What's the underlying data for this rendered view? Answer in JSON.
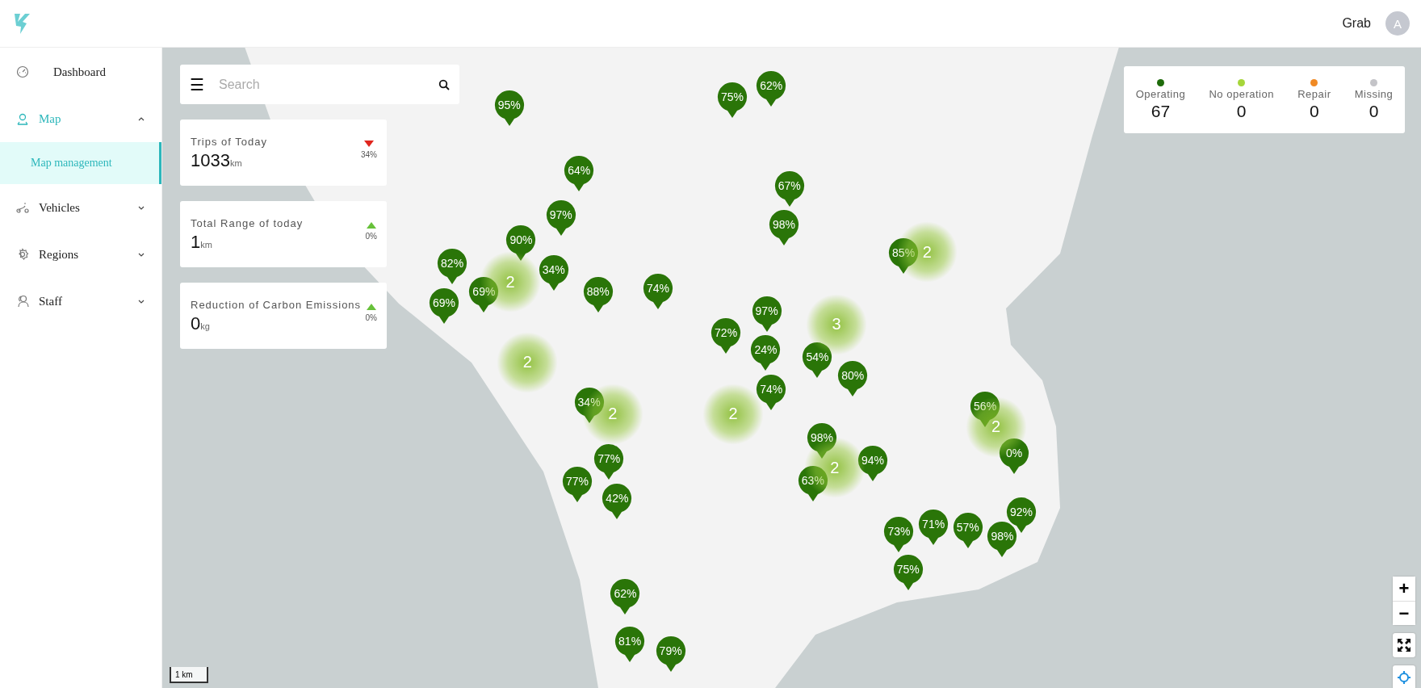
{
  "header": {
    "user_name": "Grab",
    "avatar_initial": "A"
  },
  "sidebar": {
    "items": [
      {
        "label": "Dashboard",
        "kind": "link",
        "selected": false
      },
      {
        "label": "Map",
        "kind": "group",
        "selected": true,
        "expanded": true,
        "children": [
          {
            "label": "Map management",
            "selected": true
          }
        ]
      },
      {
        "label": "Vehicles",
        "kind": "group",
        "selected": false,
        "expanded": false
      },
      {
        "label": "Regions",
        "kind": "group",
        "selected": false,
        "expanded": false
      },
      {
        "label": "Staff",
        "kind": "group",
        "selected": false,
        "expanded": false
      }
    ]
  },
  "search": {
    "menu_icon": "☰",
    "placeholder": "Search"
  },
  "stats": [
    {
      "title": "Trips of Today",
      "value": "1033",
      "unit": "km",
      "decreased": true,
      "change": "34%"
    },
    {
      "title": "Total Range of today",
      "value": "1",
      "unit": "km",
      "decreased": false,
      "change": "0%"
    },
    {
      "title": "Reduction of Carbon Emissions",
      "value": "0",
      "unit": "kg",
      "decreased": false,
      "change": "0%"
    }
  ],
  "status_legend": [
    {
      "label": "Operating",
      "count": "67",
      "color": "#1e6b0a"
    },
    {
      "label": "No operation",
      "count": "0",
      "color": "#a6d63a"
    },
    {
      "label": "Repair",
      "count": "0",
      "color": "#f08a24"
    },
    {
      "label": "Missing",
      "count": "0",
      "color": "#c4c4c8"
    }
  ],
  "vehicle_markers": [
    {
      "label": "95%"
    },
    {
      "label": "75%"
    },
    {
      "label": "62%"
    },
    {
      "label": "64%"
    },
    {
      "label": "67%"
    },
    {
      "label": "98%"
    },
    {
      "label": "97%"
    },
    {
      "label": "90%"
    },
    {
      "label": "34%"
    },
    {
      "label": "82%"
    },
    {
      "label": "69%"
    },
    {
      "label": "69%"
    },
    {
      "label": "88%"
    },
    {
      "label": "74%"
    },
    {
      "label": "72%"
    },
    {
      "label": "97%"
    },
    {
      "label": "24%"
    },
    {
      "label": "74%"
    },
    {
      "label": "54%"
    },
    {
      "label": "80%"
    },
    {
      "label": "85%"
    },
    {
      "label": "34%"
    },
    {
      "label": "56%"
    },
    {
      "label": "0%"
    },
    {
      "label": "98%"
    },
    {
      "label": "94%"
    },
    {
      "label": "63%"
    },
    {
      "label": "77%"
    },
    {
      "label": "77%"
    },
    {
      "label": "42%"
    },
    {
      "label": "73%"
    },
    {
      "label": "71%"
    },
    {
      "label": "57%"
    },
    {
      "label": "92%"
    },
    {
      "label": "98%"
    },
    {
      "label": "75%"
    },
    {
      "label": "62%"
    },
    {
      "label": "81%"
    },
    {
      "label": "79%"
    }
  ],
  "clusters": [
    {
      "count": "2"
    },
    {
      "count": "2"
    },
    {
      "count": "2"
    },
    {
      "count": "2"
    },
    {
      "count": "3"
    },
    {
      "count": "2"
    },
    {
      "count": "2"
    },
    {
      "count": "2"
    }
  ],
  "map_controls": {
    "zoom_in": "+",
    "zoom_out": "−"
  },
  "scale": "1 km"
}
